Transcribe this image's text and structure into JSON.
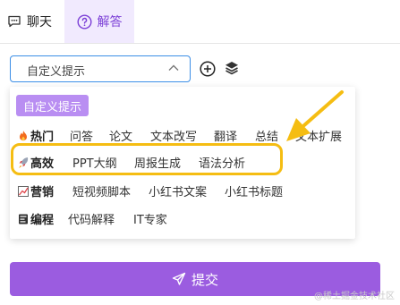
{
  "tabs": {
    "chat": "聊天",
    "qa": "解答"
  },
  "prompt_select": {
    "value": "自定义提示"
  },
  "dropdown": {
    "custom_chip": "自定义提示",
    "categories": [
      {
        "name": "热门",
        "icon": "fire-icon",
        "items": [
          "问答",
          "论文",
          "文本改写",
          "翻译",
          "总结",
          "文本扩展"
        ]
      },
      {
        "name": "高效",
        "icon": "rocket-icon",
        "items": [
          "PPT大纲",
          "周报生成",
          "语法分析"
        ]
      },
      {
        "name": "营销",
        "icon": "chart-icon",
        "items": [
          "短视频脚本",
          "小红书文案",
          "小红书标题"
        ]
      },
      {
        "name": "编程",
        "icon": "code-icon",
        "items": [
          "代码解释",
          "IT专家"
        ]
      }
    ]
  },
  "submit_label": "提交",
  "watermark": "@稀土掘金技术社区",
  "colors": {
    "accent": "#9b5ce0",
    "select_border": "#3b8ee6",
    "highlight": "#f5bd12",
    "chip": "#b98ef2"
  }
}
